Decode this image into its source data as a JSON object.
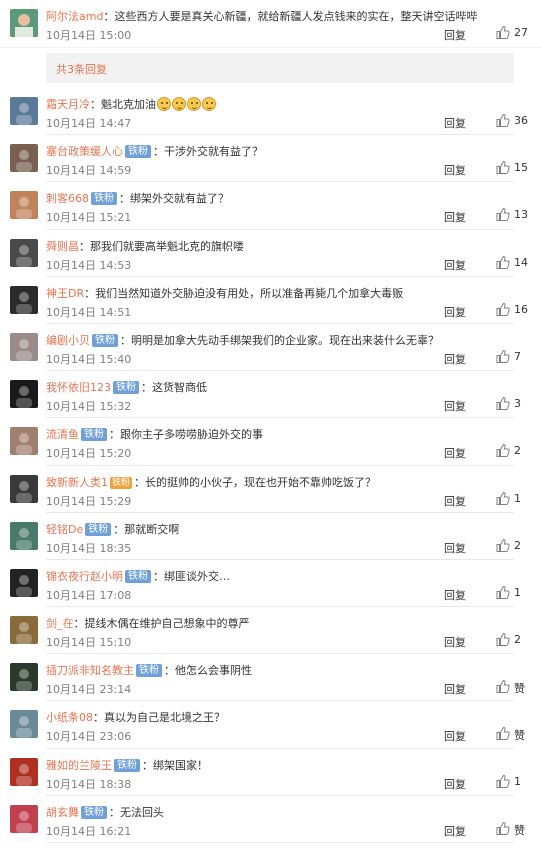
{
  "top_comment": {
    "username": "阿尔法amd",
    "text": "这些西方人要是真关心新疆，就给新疆人发点钱来的实在，整天讲空话哔哔",
    "time": "10月14日 15:00",
    "reply_label": "回复",
    "likes": "27"
  },
  "expand": {
    "label": "共3条回复"
  },
  "replies": [
    {
      "username": "霜天月冷",
      "badge": "",
      "text": "魁北克加油",
      "emoji_count": 4,
      "time": "10月14日 14:47",
      "reply_label": "回复",
      "likes": "36"
    },
    {
      "username": "塞台政策缓人心",
      "badge": "铁粉",
      "text": "干涉外交就有益了？",
      "time": "10月14日 14:59",
      "reply_label": "回复",
      "likes": "15"
    },
    {
      "username": "刺客668",
      "badge": "铁粉",
      "text": "绑架外交就有益了？",
      "time": "10月14日 15:21",
      "reply_label": "回复",
      "likes": "13"
    },
    {
      "username": "舜则昌",
      "badge": "",
      "text": "那我们就要高举魁北克的旗帜喽",
      "time": "10月14日 14:53",
      "reply_label": "回复",
      "likes": "14"
    },
    {
      "username": "神王DR",
      "badge": "",
      "text": "我们当然知道外交胁迫没有用处，所以准备再毙几个加拿大毒贩",
      "time": "10月14日 14:51",
      "reply_label": "回复",
      "likes": "16"
    },
    {
      "username": "编剧小贝",
      "badge": "铁粉",
      "text": "明明是加拿大先动手绑架我们的企业家。现在出来装什么无辜？",
      "time": "10月14日 15:40",
      "reply_label": "回复",
      "likes": "7"
    },
    {
      "username": "我怀依旧123",
      "badge": "铁粉",
      "text": "这货智商低",
      "time": "10月14日 15:32",
      "reply_label": "回复",
      "likes": "3"
    },
    {
      "username": "流清鱼",
      "badge": "铁粉",
      "text": "跟你主子多唠唠胁迫外交的事",
      "time": "10月14日 15:20",
      "reply_label": "回复",
      "likes": "2"
    },
    {
      "username": "致新新人类1",
      "badge": "",
      "gold_badge": "铁粉",
      "text": "长的挺帅的小伙子，现在也开始不靠帅吃饭了？",
      "time": "10月14日 15:29",
      "reply_label": "回复",
      "likes": "1"
    },
    {
      "username": "轻铭De",
      "badge": "铁粉",
      "text": "那就断交啊",
      "time": "10月14日 18:35",
      "reply_label": "回复",
      "likes": "2"
    },
    {
      "username": "锦衣夜行赵小明",
      "badge": "铁粉",
      "text": "绑匪谈外交…",
      "time": "10月14日 17:08",
      "reply_label": "回复",
      "likes": "1"
    },
    {
      "username": "剑_在",
      "badge": "",
      "text": "提线木偶在维护自己想象中的尊严",
      "time": "10月14日 15:10",
      "reply_label": "回复",
      "likes": "2"
    },
    {
      "username": "插刀派非知名教主",
      "badge": "铁粉",
      "text": "他怎么会事阴性",
      "time": "10月14日 23:14",
      "reply_label": "回复",
      "likes": "赞"
    },
    {
      "username": "小纸条08",
      "badge": "",
      "text": "真以为自己是北境之王？",
      "time": "10月14日 23:06",
      "reply_label": "回复",
      "likes": "赞"
    },
    {
      "username": "雅如的兰陵王",
      "badge": "铁粉",
      "text": "绑架国家！",
      "time": "10月14日 18:38",
      "reply_label": "回复",
      "likes": "1"
    },
    {
      "username": "胡玄舞",
      "badge": "铁粉",
      "text": "无法回头",
      "time": "10月14日 16:21",
      "reply_label": "回复",
      "likes": "赞"
    }
  ],
  "avatar_colors": [
    "#5a7a9a",
    "#7a6050",
    "#c0835a",
    "#4a4a4a",
    "#2a2a2a",
    "#9a8a8a",
    "#1a1a1a",
    "#a08070",
    "#3a3a3a",
    "#4a7a6a",
    "#222222",
    "#8a6a3a",
    "#2a3a2a",
    "#6a8a9a",
    "#b03020",
    "#c04050"
  ],
  "top_avatar_color": "#5a9a7a",
  "colors": {
    "username": "#eb7350",
    "badge": "#6fa0d8",
    "meta": "#808080"
  }
}
